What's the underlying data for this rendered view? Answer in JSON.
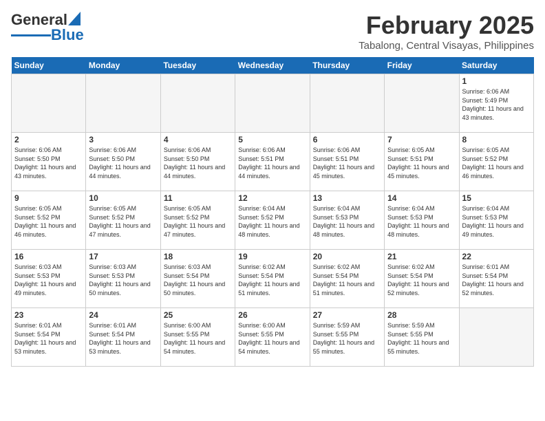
{
  "header": {
    "logo_general": "General",
    "logo_blue": "Blue",
    "month_year": "February 2025",
    "location": "Tabalong, Central Visayas, Philippines"
  },
  "days_of_week": [
    "Sunday",
    "Monday",
    "Tuesday",
    "Wednesday",
    "Thursday",
    "Friday",
    "Saturday"
  ],
  "weeks": [
    {
      "days": [
        {
          "num": "",
          "info": ""
        },
        {
          "num": "",
          "info": ""
        },
        {
          "num": "",
          "info": ""
        },
        {
          "num": "",
          "info": ""
        },
        {
          "num": "",
          "info": ""
        },
        {
          "num": "",
          "info": ""
        },
        {
          "num": "1",
          "info": "Sunrise: 6:06 AM\nSunset: 5:49 PM\nDaylight: 11 hours and 43 minutes."
        }
      ]
    },
    {
      "days": [
        {
          "num": "2",
          "info": "Sunrise: 6:06 AM\nSunset: 5:50 PM\nDaylight: 11 hours and 43 minutes."
        },
        {
          "num": "3",
          "info": "Sunrise: 6:06 AM\nSunset: 5:50 PM\nDaylight: 11 hours and 44 minutes."
        },
        {
          "num": "4",
          "info": "Sunrise: 6:06 AM\nSunset: 5:50 PM\nDaylight: 11 hours and 44 minutes."
        },
        {
          "num": "5",
          "info": "Sunrise: 6:06 AM\nSunset: 5:51 PM\nDaylight: 11 hours and 44 minutes."
        },
        {
          "num": "6",
          "info": "Sunrise: 6:06 AM\nSunset: 5:51 PM\nDaylight: 11 hours and 45 minutes."
        },
        {
          "num": "7",
          "info": "Sunrise: 6:05 AM\nSunset: 5:51 PM\nDaylight: 11 hours and 45 minutes."
        },
        {
          "num": "8",
          "info": "Sunrise: 6:05 AM\nSunset: 5:52 PM\nDaylight: 11 hours and 46 minutes."
        }
      ]
    },
    {
      "days": [
        {
          "num": "9",
          "info": "Sunrise: 6:05 AM\nSunset: 5:52 PM\nDaylight: 11 hours and 46 minutes."
        },
        {
          "num": "10",
          "info": "Sunrise: 6:05 AM\nSunset: 5:52 PM\nDaylight: 11 hours and 47 minutes."
        },
        {
          "num": "11",
          "info": "Sunrise: 6:05 AM\nSunset: 5:52 PM\nDaylight: 11 hours and 47 minutes."
        },
        {
          "num": "12",
          "info": "Sunrise: 6:04 AM\nSunset: 5:52 PM\nDaylight: 11 hours and 48 minutes."
        },
        {
          "num": "13",
          "info": "Sunrise: 6:04 AM\nSunset: 5:53 PM\nDaylight: 11 hours and 48 minutes."
        },
        {
          "num": "14",
          "info": "Sunrise: 6:04 AM\nSunset: 5:53 PM\nDaylight: 11 hours and 48 minutes."
        },
        {
          "num": "15",
          "info": "Sunrise: 6:04 AM\nSunset: 5:53 PM\nDaylight: 11 hours and 49 minutes."
        }
      ]
    },
    {
      "days": [
        {
          "num": "16",
          "info": "Sunrise: 6:03 AM\nSunset: 5:53 PM\nDaylight: 11 hours and 49 minutes."
        },
        {
          "num": "17",
          "info": "Sunrise: 6:03 AM\nSunset: 5:53 PM\nDaylight: 11 hours and 50 minutes."
        },
        {
          "num": "18",
          "info": "Sunrise: 6:03 AM\nSunset: 5:54 PM\nDaylight: 11 hours and 50 minutes."
        },
        {
          "num": "19",
          "info": "Sunrise: 6:02 AM\nSunset: 5:54 PM\nDaylight: 11 hours and 51 minutes."
        },
        {
          "num": "20",
          "info": "Sunrise: 6:02 AM\nSunset: 5:54 PM\nDaylight: 11 hours and 51 minutes."
        },
        {
          "num": "21",
          "info": "Sunrise: 6:02 AM\nSunset: 5:54 PM\nDaylight: 11 hours and 52 minutes."
        },
        {
          "num": "22",
          "info": "Sunrise: 6:01 AM\nSunset: 5:54 PM\nDaylight: 11 hours and 52 minutes."
        }
      ]
    },
    {
      "days": [
        {
          "num": "23",
          "info": "Sunrise: 6:01 AM\nSunset: 5:54 PM\nDaylight: 11 hours and 53 minutes."
        },
        {
          "num": "24",
          "info": "Sunrise: 6:01 AM\nSunset: 5:54 PM\nDaylight: 11 hours and 53 minutes."
        },
        {
          "num": "25",
          "info": "Sunrise: 6:00 AM\nSunset: 5:55 PM\nDaylight: 11 hours and 54 minutes."
        },
        {
          "num": "26",
          "info": "Sunrise: 6:00 AM\nSunset: 5:55 PM\nDaylight: 11 hours and 54 minutes."
        },
        {
          "num": "27",
          "info": "Sunrise: 5:59 AM\nSunset: 5:55 PM\nDaylight: 11 hours and 55 minutes."
        },
        {
          "num": "28",
          "info": "Sunrise: 5:59 AM\nSunset: 5:55 PM\nDaylight: 11 hours and 55 minutes."
        },
        {
          "num": "",
          "info": ""
        }
      ]
    }
  ]
}
